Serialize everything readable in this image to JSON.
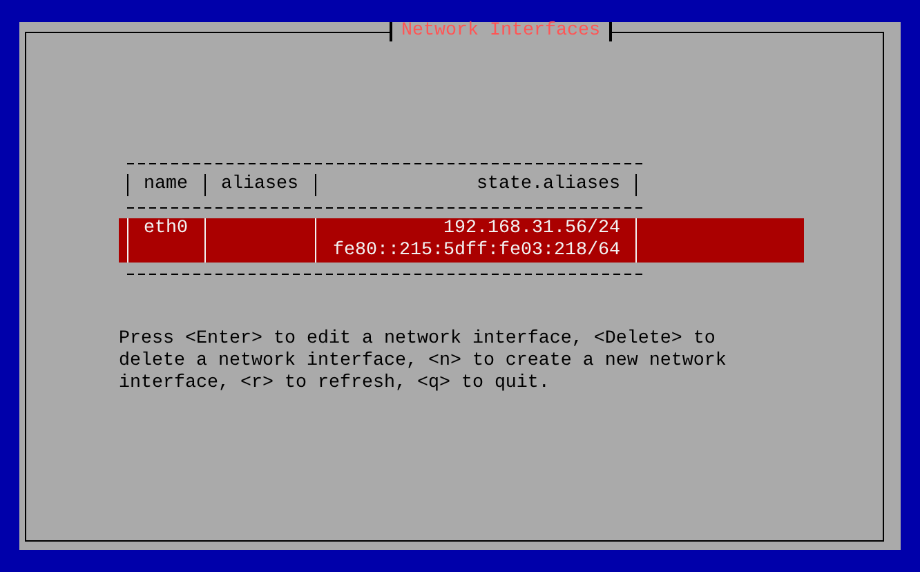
{
  "window": {
    "title": "Network Interfaces"
  },
  "table": {
    "columns": [
      "name",
      "aliases",
      "state.aliases"
    ],
    "rows": [
      {
        "name": "eth0",
        "state_aliases": [
          "192.168.31.56/24",
          "fe80::215:5dff:fe03:218/64"
        ],
        "selected": true
      }
    ]
  },
  "help": "Press <Enter> to edit a network interface, <Delete> to delete a network interface, <n> to create a new network interface, <r> to refresh, <q> to quit."
}
